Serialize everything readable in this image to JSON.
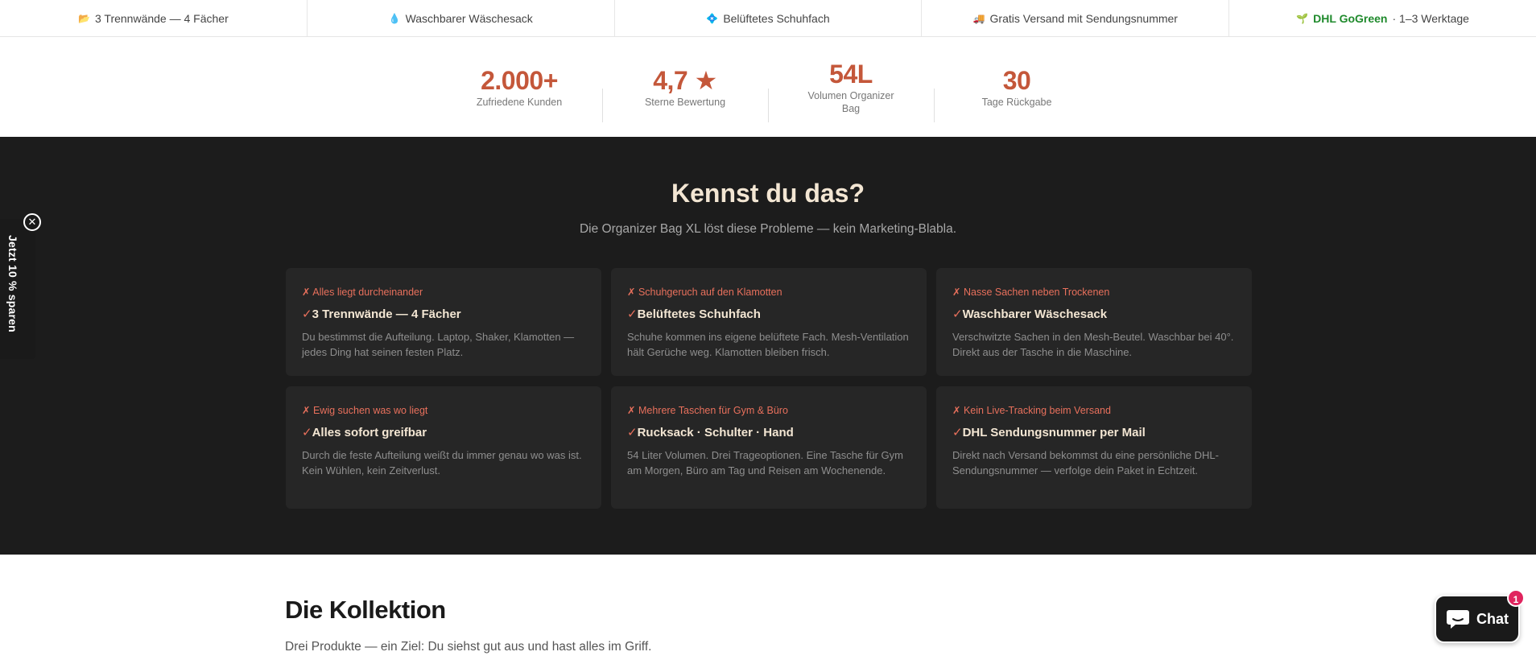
{
  "feature_bar": [
    {
      "icon": "folder-icon",
      "glyph": "📂",
      "text": "3 Trennwände — 4 Fächer"
    },
    {
      "icon": "droplet-icon",
      "glyph": "💧",
      "text": "Waschbarer Wäschesack"
    },
    {
      "icon": "sparkle-icon",
      "glyph": "💠",
      "text": "Belüftetes Schuhfach"
    },
    {
      "icon": "truck-icon",
      "glyph": "🚚",
      "text": "Gratis Versand mit Sendungsnummer"
    },
    {
      "icon": "sprout-icon",
      "glyph": "🌱",
      "text_highlight": "DHL GoGreen",
      "text": "· 1–3 Werktage"
    }
  ],
  "stats": [
    {
      "value": "2.000+",
      "label": "Zufriedene Kunden"
    },
    {
      "value": "4,7 ★",
      "label": "Sterne Bewertung"
    },
    {
      "value": "54L",
      "label": "Volumen Organizer Bag"
    },
    {
      "value": "30",
      "label": "Tage Rückgabe"
    }
  ],
  "problems": {
    "title": "Kennst du das?",
    "subtitle": "Die Organizer Bag XL löst diese Probleme — kein Marketing-Blabla.",
    "problem_mark": "✗",
    "solution_mark": "✓",
    "cards": [
      {
        "problem": "Alles liegt durcheinander",
        "solution": "3 Trennwände — 4 Fächer",
        "desc": "Du bestimmst die Aufteilung. Laptop, Shaker, Klamotten — jedes Ding hat seinen festen Platz."
      },
      {
        "problem": "Schuhgeruch auf den Klamotten",
        "solution": "Belüftetes Schuhfach",
        "desc": "Schuhe kommen ins eigene belüftete Fach. Mesh-Ventilation hält Gerüche weg. Klamotten bleiben frisch."
      },
      {
        "problem": "Nasse Sachen neben Trockenen",
        "solution": "Waschbarer Wäschesack",
        "desc": "Verschwitzte Sachen in den Mesh-Beutel. Waschbar bei 40°. Direkt aus der Tasche in die Maschine."
      },
      {
        "problem": "Ewig suchen was wo liegt",
        "solution": "Alles sofort greifbar",
        "desc": "Durch die feste Aufteilung weißt du immer genau wo was ist. Kein Wühlen, kein Zeitverlust."
      },
      {
        "problem": "Mehrere Taschen für Gym & Büro",
        "solution": "Rucksack · Schulter · Hand",
        "desc": "54 Liter Volumen. Drei Trageoptionen. Eine Tasche für Gym am Morgen, Büro am Tag und Reisen am Wochenende."
      },
      {
        "problem": "Kein Live-Tracking beim Versand",
        "solution": "DHL Sendungsnummer per Mail",
        "desc": "Direkt nach Versand bekommst du eine persönliche DHL-Sendungsnummer — verfolge dein Paket in Echtzeit."
      }
    ]
  },
  "collection": {
    "title": "Die Kollektion",
    "subtitle": "Drei Produkte — ein Ziel: Du siehst gut aus und hast alles im Griff."
  },
  "side_tab": {
    "label": "Jetzt 10 % sparen",
    "close_glyph": "✕"
  },
  "chat": {
    "label": "Chat",
    "badge": "1"
  },
  "colors": {
    "accent": "#c4573a",
    "dark_bg": "#1c1c1c",
    "card_bg": "#262626",
    "cream": "#f3e6d3",
    "problem_red": "#e8705c",
    "green": "#1f8a2c"
  }
}
